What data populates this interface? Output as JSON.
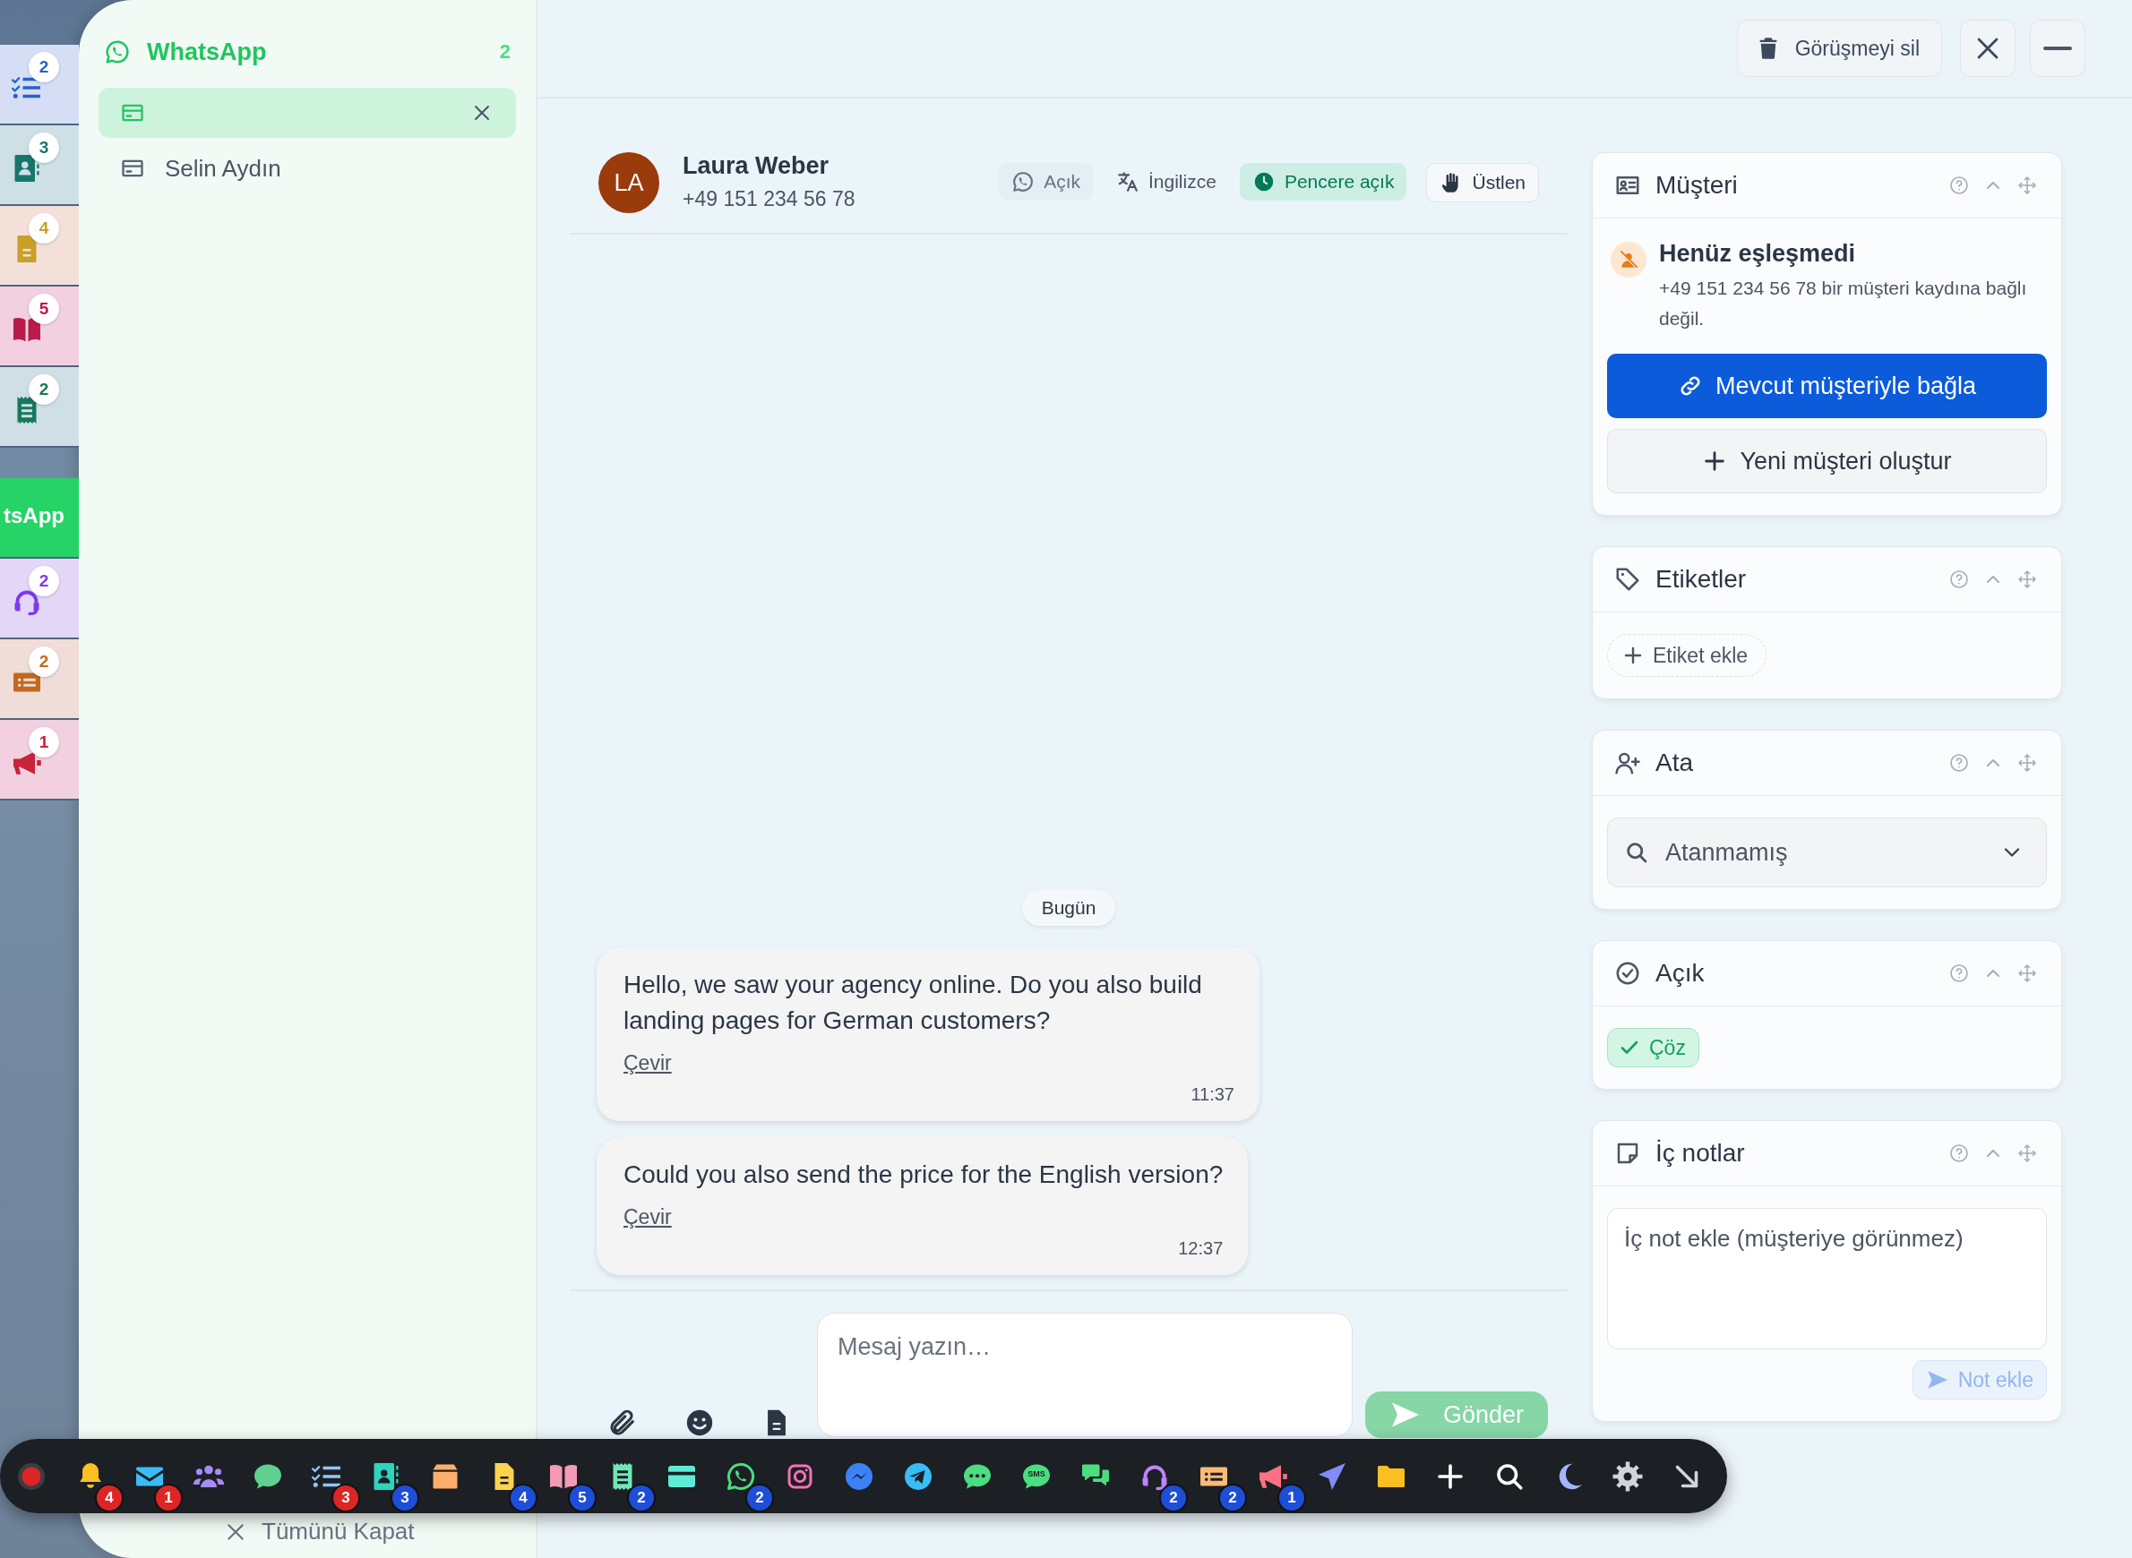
{
  "rail": {
    "tabs": [
      {
        "kind": "checklist",
        "badge": "2",
        "selected": false
      },
      {
        "kind": "contacts",
        "badge": "3",
        "selected": false
      },
      {
        "kind": "file",
        "badge": "4",
        "selected": false
      },
      {
        "kind": "book",
        "badge": "5",
        "selected": false
      },
      {
        "kind": "receipt",
        "badge": "2",
        "selected": false
      },
      {
        "kind": "whatsapp",
        "label": "tsApp",
        "selected": true
      },
      {
        "kind": "headset",
        "badge": "2",
        "selected": false
      },
      {
        "kind": "listcard",
        "badge": "2",
        "selected": false
      },
      {
        "kind": "megaphone",
        "badge": "1",
        "selected": false
      }
    ]
  },
  "sidebar": {
    "title": "WhatsApp",
    "count": "2",
    "items": [
      {
        "selected": true,
        "closable": true
      },
      {
        "label": "Selin Aydın",
        "selected": false,
        "closable": false
      }
    ],
    "close_all": "Tümünü Kapat"
  },
  "topbar": {
    "delete_button": "Görüşmeyi sil"
  },
  "contact": {
    "initials": "LA",
    "name": "Laura Weber",
    "phone": "+49 151 234 56 78",
    "chips": [
      {
        "kind": "channel",
        "label": "Açık"
      },
      {
        "kind": "language",
        "label": "İngilizce"
      },
      {
        "kind": "window",
        "label": "Pencere açık"
      },
      {
        "kind": "claim",
        "label": "Üstlen"
      }
    ]
  },
  "day_divider": "Bugün",
  "messages": [
    {
      "text": "Hello, we saw your agency online. Do you also build landing pages for German customers?",
      "translate": "Çevir",
      "time": "11:37"
    },
    {
      "text": "Could you also send the price for the English version?",
      "translate": "Çevir",
      "time": "12:37"
    }
  ],
  "composer": {
    "placeholder": "Mesaj yazın…",
    "send": "Gönder",
    "send_disabled": true
  },
  "panels": [
    {
      "kind": "customer",
      "title": "Müşteri",
      "status": "Henüz eşleşmedi",
      "note": "+49 151 234 56 78 bir müşteri kaydına bağlı değil.",
      "link_button": "Mevcut müşteriyle bağla",
      "create_button": "Yeni müşteri oluştur"
    },
    {
      "kind": "tags",
      "title": "Etiketler",
      "add": "Etiket ekle"
    },
    {
      "kind": "assign",
      "title": "Ata",
      "value": "Atanmamış"
    },
    {
      "kind": "status",
      "title": "Açık",
      "resolve": "Çöz"
    },
    {
      "kind": "notes",
      "title": "İç notlar",
      "placeholder": "İç not ekle (müşteriye görünmez)",
      "submit": "Not ekle",
      "submit_disabled": true
    }
  ],
  "taskbar": {
    "items": [
      {
        "kind": "record"
      },
      {
        "kind": "bell",
        "badge": {
          "text": "4",
          "color": "#dc2626"
        }
      },
      {
        "kind": "mail",
        "badge": {
          "text": "1",
          "color": "#dc2626"
        }
      },
      {
        "kind": "users"
      },
      {
        "kind": "chat"
      },
      {
        "kind": "checklist",
        "badge": {
          "text": "3",
          "color": "#dc2626"
        }
      },
      {
        "kind": "contacts",
        "badge": {
          "text": "3",
          "color": "#1d4ed8"
        }
      },
      {
        "kind": "box"
      },
      {
        "kind": "file",
        "badge": {
          "text": "4",
          "color": "#1d4ed8"
        }
      },
      {
        "kind": "book",
        "badge": {
          "text": "5",
          "color": "#1d4ed8"
        }
      },
      {
        "kind": "receipt",
        "badge": {
          "text": "2",
          "color": "#1d4ed8"
        }
      },
      {
        "kind": "wallet"
      },
      {
        "kind": "whatsapp",
        "badge": {
          "text": "2",
          "color": "#1d4ed8"
        }
      },
      {
        "kind": "instagram"
      },
      {
        "kind": "messenger"
      },
      {
        "kind": "telegram"
      },
      {
        "kind": "chatdots"
      },
      {
        "kind": "sms",
        "label": "SMS"
      },
      {
        "kind": "chats"
      },
      {
        "kind": "headset",
        "badge": {
          "text": "2",
          "color": "#1d4ed8"
        }
      },
      {
        "kind": "listcard",
        "badge": {
          "text": "2",
          "color": "#1d4ed8"
        }
      },
      {
        "kind": "megaphone",
        "badge": {
          "text": "1",
          "color": "#1d4ed8"
        }
      },
      {
        "kind": "plane"
      },
      {
        "kind": "folder"
      },
      {
        "kind": "plus"
      },
      {
        "kind": "search"
      },
      {
        "kind": "moon"
      },
      {
        "kind": "gear"
      },
      {
        "kind": "arrow"
      }
    ]
  }
}
